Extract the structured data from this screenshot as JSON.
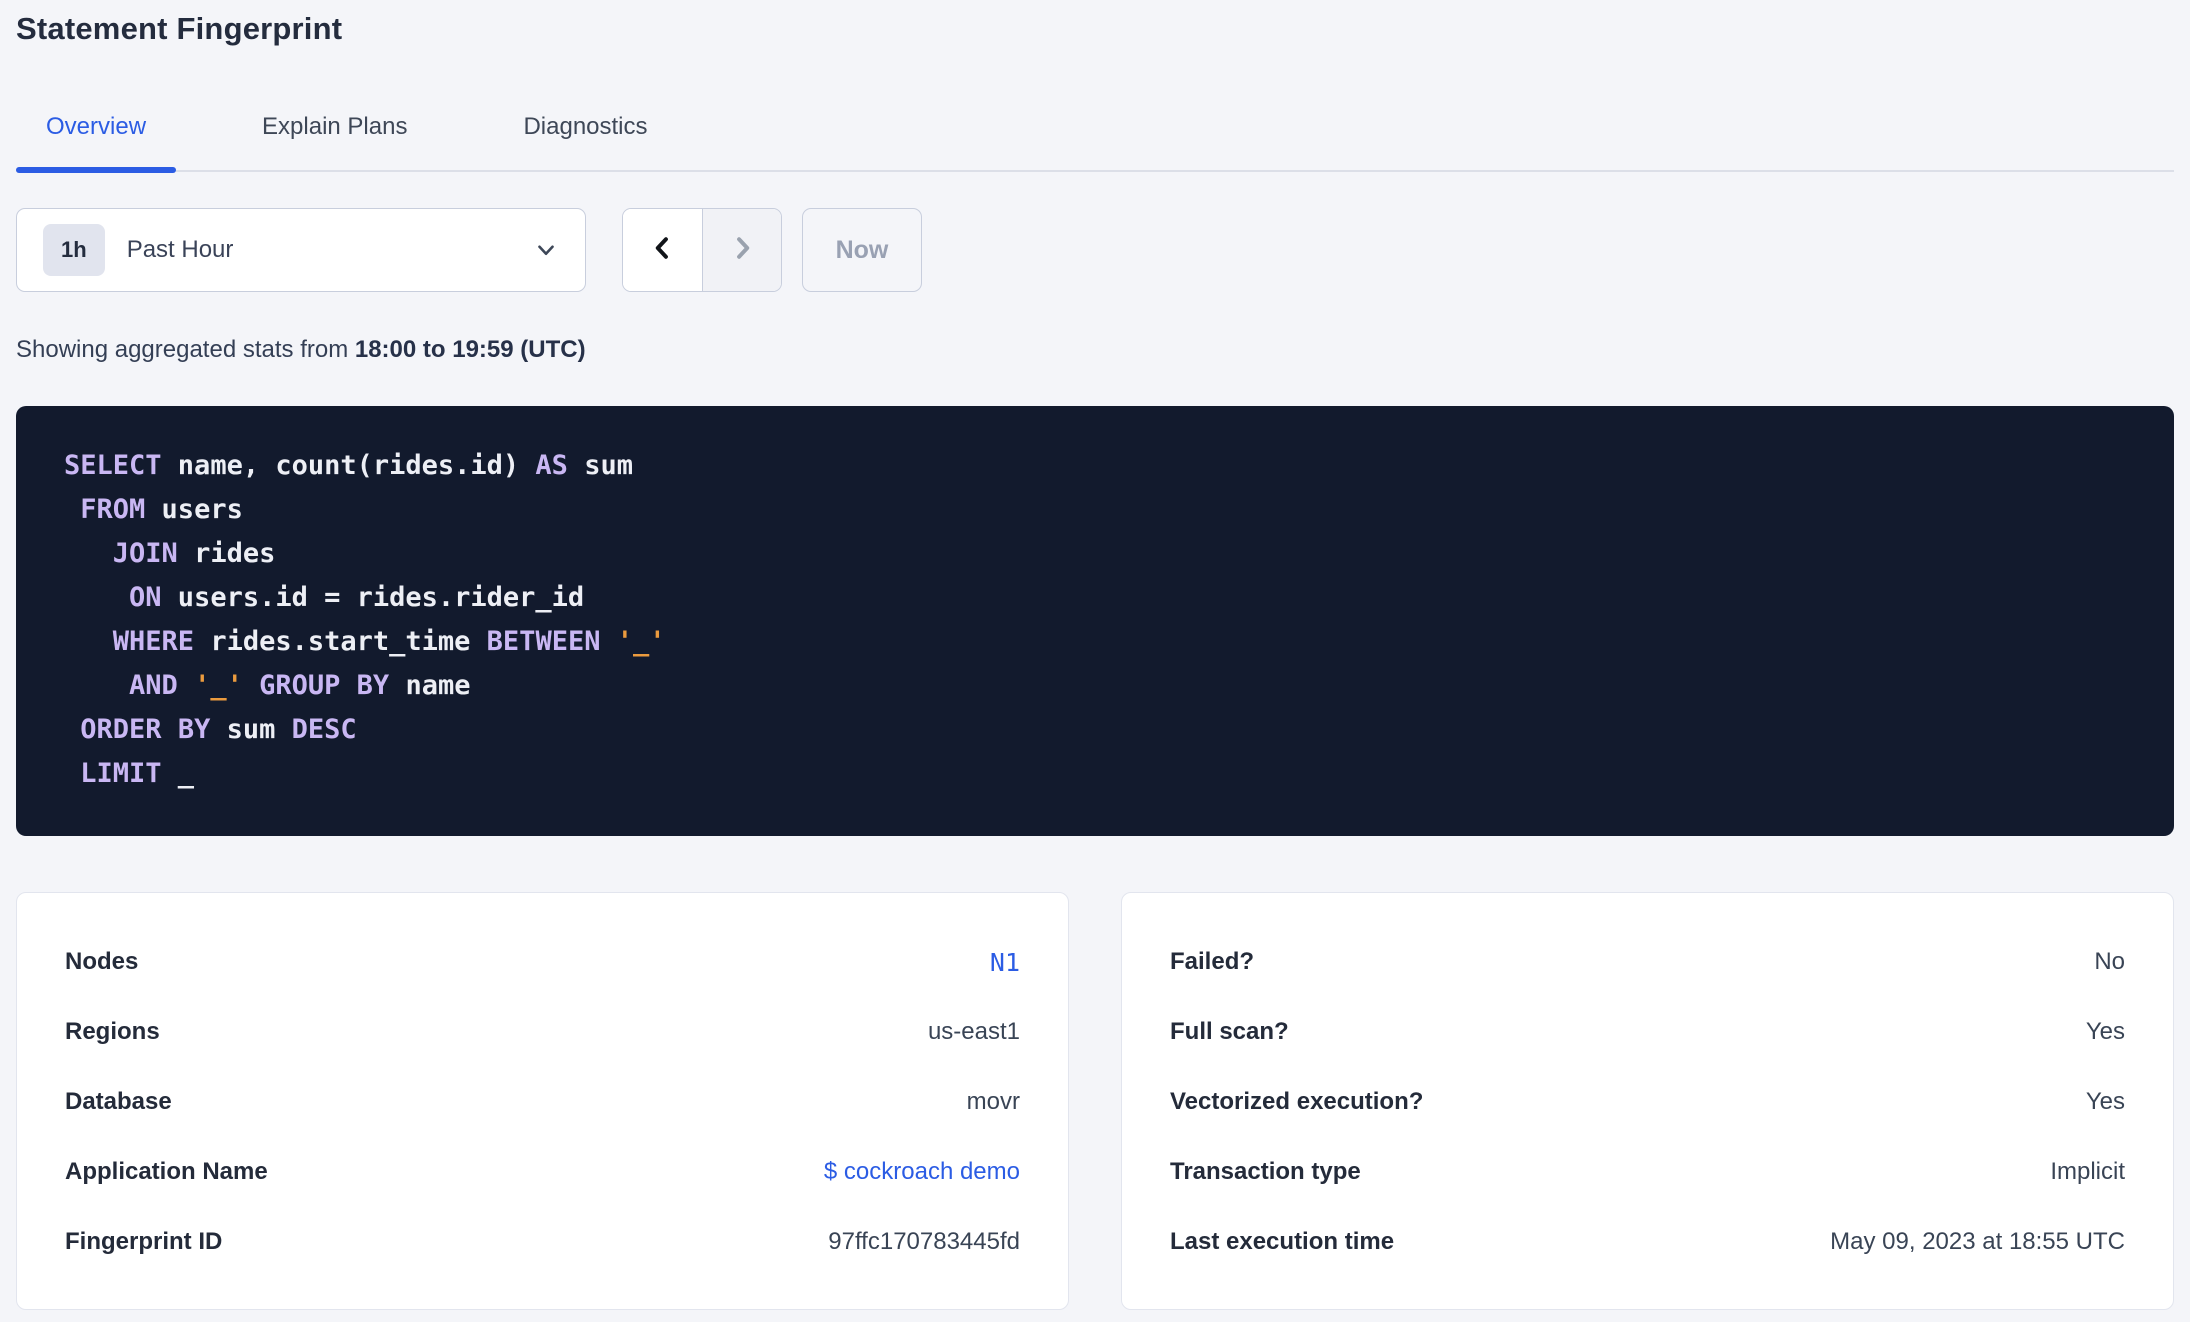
{
  "page": {
    "title": "Statement Fingerprint"
  },
  "tabs": [
    {
      "label": "Overview"
    },
    {
      "label": "Explain Plans"
    },
    {
      "label": "Diagnostics"
    }
  ],
  "time_picker": {
    "range_badge": "1h",
    "range_label": "Past Hour",
    "now_label": "Now"
  },
  "stats_line": {
    "prefix": "Showing aggregated stats from ",
    "range_bold": "18:00 to 19:59 (UTC)"
  },
  "sql": {
    "lines": [
      [
        [
          "kw",
          "SELECT"
        ],
        [
          "id",
          " name, count(rides.id) "
        ],
        [
          "kw",
          "AS"
        ],
        [
          "id",
          " sum"
        ]
      ],
      [
        [
          "id",
          " "
        ],
        [
          "kw",
          "FROM"
        ],
        [
          "id",
          " users"
        ]
      ],
      [
        [
          "id",
          "   "
        ],
        [
          "kw",
          "JOIN"
        ],
        [
          "id",
          " rides"
        ]
      ],
      [
        [
          "id",
          "    "
        ],
        [
          "kw",
          "ON"
        ],
        [
          "id",
          " users.id = rides.rider_id"
        ]
      ],
      [
        [
          "id",
          "   "
        ],
        [
          "kw",
          "WHERE"
        ],
        [
          "id",
          " rides.start_time "
        ],
        [
          "kw",
          "BETWEEN"
        ],
        [
          "id",
          " "
        ],
        [
          "str",
          "'_'"
        ]
      ],
      [
        [
          "id",
          "    "
        ],
        [
          "kw",
          "AND"
        ],
        [
          "id",
          " "
        ],
        [
          "str",
          "'_'"
        ],
        [
          "id",
          " "
        ],
        [
          "kw",
          "GROUP"
        ],
        [
          "id",
          " "
        ],
        [
          "kw",
          "BY"
        ],
        [
          "id",
          " name"
        ]
      ],
      [
        [
          "id",
          " "
        ],
        [
          "kw",
          "ORDER"
        ],
        [
          "id",
          " "
        ],
        [
          "kw",
          "BY"
        ],
        [
          "id",
          " sum "
        ],
        [
          "kw",
          "DESC"
        ]
      ],
      [
        [
          "id",
          " "
        ],
        [
          "kw",
          "LIMIT"
        ],
        [
          "id",
          " _"
        ]
      ]
    ]
  },
  "details_left": {
    "rows": [
      {
        "label": "Nodes",
        "value": "N1"
      },
      {
        "label": "Regions",
        "value": "us-east1"
      },
      {
        "label": "Database",
        "value": "movr"
      },
      {
        "label": "Application Name",
        "value": "$ cockroach demo"
      },
      {
        "label": "Fingerprint ID",
        "value": "97ffc170783445fd"
      }
    ]
  },
  "details_right": {
    "rows": [
      {
        "label": "Failed?",
        "value": "No"
      },
      {
        "label": "Full scan?",
        "value": "Yes"
      },
      {
        "label": "Vectorized execution?",
        "value": "Yes"
      },
      {
        "label": "Transaction type",
        "value": "Implicit"
      },
      {
        "label": "Last execution time",
        "value": "May 09, 2023 at 18:55 UTC"
      }
    ]
  },
  "icons": {
    "time_select_chevron": "chevron-down-icon",
    "prev": "chevron-left-icon",
    "next": "chevron-right-icon"
  },
  "colors": {
    "accent_blue": "#2b5ce4",
    "page_bg": "#f4f5f9",
    "sql_bg": "#121a2d",
    "sql_keyword": "#c9b7f3",
    "sql_plain": "#edeff5",
    "sql_string": "#eb9b3e",
    "disabled_text": "#99a1b3"
  }
}
